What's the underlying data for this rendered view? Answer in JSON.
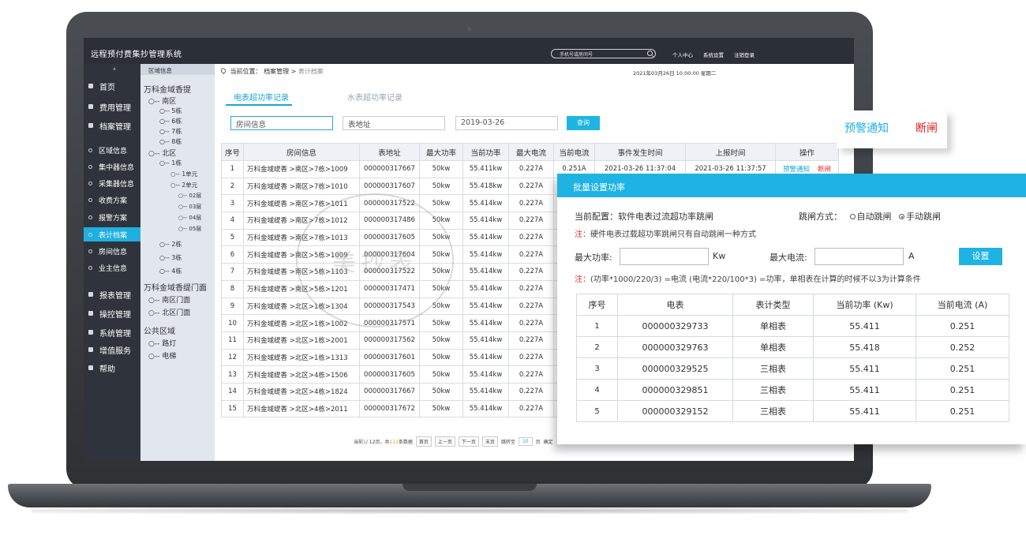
{
  "app": {
    "title": "远程预付费集抄管理系统",
    "search_placeholder": "手机号或房间号",
    "top_links": [
      "个人中心",
      "系统设置",
      "注销登录"
    ]
  },
  "nav": {
    "items": [
      {
        "label": "首页",
        "icon": "home-icon"
      },
      {
        "label": "费用管理",
        "icon": "coin-icon"
      },
      {
        "label": "档案管理",
        "icon": "archive-icon"
      },
      {
        "label": "区域信息",
        "icon": "region-icon"
      },
      {
        "label": "集中器信息",
        "icon": "concentrator-icon"
      },
      {
        "label": "采集器信息",
        "icon": "collector-icon"
      },
      {
        "label": "收费方案",
        "icon": "fee-plan-icon"
      },
      {
        "label": "报警方案",
        "icon": "alarm-icon"
      },
      {
        "label": "表计档案",
        "icon": "meter-icon"
      },
      {
        "label": "房间信息",
        "icon": "room-icon"
      },
      {
        "label": "业主信息",
        "icon": "owner-icon"
      },
      {
        "label": "报表管理",
        "icon": "report-icon"
      },
      {
        "label": "操控管理",
        "icon": "control-icon"
      },
      {
        "label": "系统管理",
        "icon": "system-icon"
      },
      {
        "label": "增值服务",
        "icon": "service-icon"
      },
      {
        "label": "帮助",
        "icon": "help-icon"
      }
    ]
  },
  "tree": {
    "header": "区域信息",
    "nodes": [
      "万科金域香提",
      "○-- 南区",
      "○-- 5栋",
      "○-- 6栋",
      "○-- 7栋",
      "○-- 8栋",
      "○-- 北区",
      "○-- 1栋",
      "○-- 1单元",
      "○-- 2单元",
      "○-- 02层",
      "○-- 03层",
      "○-- 04层",
      "○-- 05层",
      "○-- 2栋",
      "○-- 3栋",
      "○-- 4栋",
      "万科金域香缇门面",
      "○-- 南区门面",
      "○-- 北区门面",
      "公共区域",
      "○-- 路灯",
      "○-- 电梯"
    ]
  },
  "content": {
    "crumb_prefix": "当前位置：",
    "crumb_mid": "档案管理 >",
    "crumb_last": "表计档案",
    "datetime": "2021年03月26日    10:00:00    星期二",
    "tab_active": "电表超功率记录",
    "tab_inactive": "水表超功率记录",
    "room_field": "房间信息",
    "addr_field": "表地址",
    "date_field": "2019-03-26",
    "query_label": "查询",
    "columns": [
      "序号",
      "房间信息",
      "表地址",
      "最大功率",
      "当前功率",
      "最大电流",
      "当前电流",
      "事件发生时间",
      "上报时间",
      "操作"
    ],
    "rows": [
      [
        "1",
        "万科金域缇香 >南区>7栋>1009",
        "000000317667",
        "50kw",
        "55.411kw",
        "0.227A",
        "0.251A",
        "2021-03-26 11:37:04",
        "2021-03-26 11:37:57"
      ],
      [
        "2",
        "万科金域缇香 >南区>7栋>1010",
        "000000317607",
        "50kw",
        "55.418kw",
        "0.227A",
        "",
        "",
        ""
      ],
      [
        "3",
        "万科金域缇香 >南区>7栋>1011",
        "000000317522",
        "50kw",
        "55.414kw",
        "0.227A",
        "",
        "",
        ""
      ],
      [
        "4",
        "万科金域缇香 >南区>7栋>1012",
        "000000317486",
        "50kw",
        "55.414kw",
        "0.227A",
        "",
        "",
        ""
      ],
      [
        "5",
        "万科金域缇香 >南区>7栋>1013",
        "000000317605",
        "50kw",
        "55.414kw",
        "0.227A",
        "",
        "",
        ""
      ],
      [
        "6",
        "万科金域缇香 >南区>5栋>1009",
        "000000317604",
        "50kw",
        "55.414kw",
        "0.227A",
        "",
        "",
        ""
      ],
      [
        "7",
        "万科金域缇香 >南区>5栋>1103",
        "000000317522",
        "50kw",
        "55.414kw",
        "0.227A",
        "",
        "",
        ""
      ],
      [
        "8",
        "万科金域缇香 >南区>5栋>1201",
        "000000317471",
        "50kw",
        "55.414kw",
        "0.227A",
        "",
        "",
        ""
      ],
      [
        "9",
        "万科金域缇香 >北区>1栋>1304",
        "000000317543",
        "50kw",
        "55.414kw",
        "0.227A",
        "",
        "",
        ""
      ],
      [
        "10",
        "万科金域缇香 >北区>1栋>1002",
        "000000317571",
        "50kw",
        "55.414kw",
        "0.227A",
        "",
        "",
        ""
      ],
      [
        "11",
        "万科金域缇香 >北区>1栋>2001",
        "000000317562",
        "50kw",
        "55.414kw",
        "0.227A",
        "",
        "",
        ""
      ],
      [
        "12",
        "万科金域缇香 >北区>1栋>1313",
        "000000317601",
        "50kw",
        "55.414kw",
        "0.227A",
        "",
        "",
        ""
      ],
      [
        "13",
        "万科金域缇香 >北区>4栋>1506",
        "000000317605",
        "50kw",
        "55.414kw",
        "0.227A",
        "",
        "",
        ""
      ],
      [
        "14",
        "万科金域缇香 >北区>4栋>1824",
        "000000317667",
        "50kw",
        "55.414kw",
        "0.227A",
        "",
        "",
        ""
      ],
      [
        "15",
        "万科金域缇香 >北区>4栋>2011",
        "000000317672",
        "50kw",
        "55.414kw",
        "0.227A",
        "",
        "",
        ""
      ]
    ],
    "op_warn": "预警通知",
    "op_cut": "断闸",
    "pager": {
      "prefix": "当前",
      "current": "1",
      "total_text": "/ 12页，共",
      "count": "112",
      "count_suffix": "条数据",
      "first": "首页",
      "prev": "上一页",
      "next": "下一页",
      "last": "末页",
      "goto": "跳转至",
      "page_input": "10",
      "page_unit": "页",
      "confirm": "确定"
    }
  },
  "float_op": {
    "warn": "预警通知",
    "cut": "断闸"
  },
  "panel": {
    "title": "批量设置功率",
    "config": "当前配置：软件电表过流超功率跳闸",
    "mode_label": "跳闸方式：",
    "mode_auto": "自动跳闸",
    "mode_manual": "手动跳闸",
    "note1_prefix": "注：",
    "note1": "硬件电表过载超功率跳闸只有自动跳闸一种方式",
    "max_power_label": "最大功率:",
    "power_unit": "Kw",
    "max_current_label": "最大电流:",
    "current_unit": "A",
    "set_label": "设置",
    "note2_prefix": "注：",
    "note2": "(功率*1000/220/3) =电流 (电流*220/100*3) =功率，单相表在计算的时候不以3为计算条件",
    "columns": [
      "序号",
      "电表",
      "表计类型",
      "当前功率 (Kw)",
      "当前电流 (A)"
    ],
    "rows": [
      [
        "1",
        "000000329733",
        "单相表",
        "55.411",
        "0.251"
      ],
      [
        "2",
        "000000329763",
        "单相表",
        "55.418",
        "0.252"
      ],
      [
        "3",
        "000000329525",
        "三相表",
        "55.411",
        "0.251"
      ],
      [
        "4",
        "000000329851",
        "三相表",
        "55.411",
        "0.251"
      ],
      [
        "5",
        "000000329152",
        "三相表",
        "55.411",
        "0.251"
      ]
    ]
  },
  "watermark": "美抄表"
}
